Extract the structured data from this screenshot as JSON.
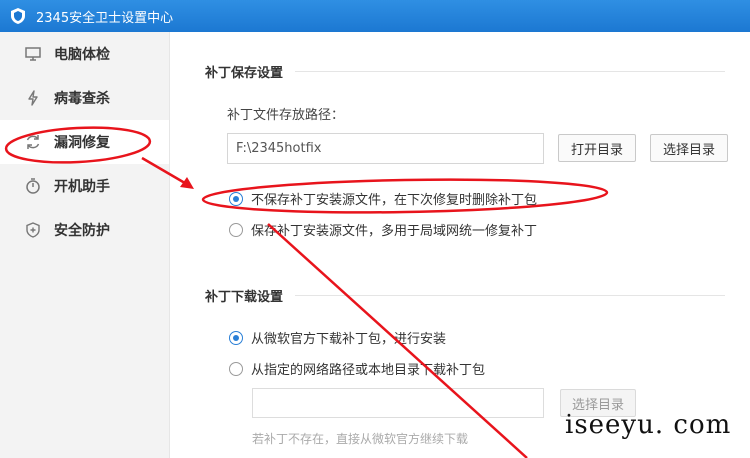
{
  "window": {
    "title": "2345安全卫士设置中心"
  },
  "sidebar": {
    "items": [
      {
        "label": "电脑体检",
        "icon": "monitor-icon"
      },
      {
        "label": "病毒查杀",
        "icon": "lightning-icon"
      },
      {
        "label": "漏洞修复",
        "icon": "refresh-icon"
      },
      {
        "label": "开机助手",
        "icon": "stopwatch-icon"
      },
      {
        "label": "安全防护",
        "icon": "shield-plus-icon"
      }
    ],
    "active_index": 2
  },
  "patch_save": {
    "section_title": "补丁保存设置",
    "path_label": "补丁文件存放路径：",
    "path_value": "F:\\2345hotfix",
    "open_dir_button": "打开目录",
    "choose_dir_button": "选择目录",
    "options": [
      {
        "label": "不保存补丁安装源文件，在下次修复时删除补丁包",
        "checked": true
      },
      {
        "label": "保存补丁安装源文件，多用于局域网统一修复补丁",
        "checked": false
      }
    ]
  },
  "patch_download": {
    "section_title": "补丁下载设置",
    "options": [
      {
        "label": "从微软官方下载补丁包，进行安装",
        "checked": true
      },
      {
        "label": "从指定的网络路径或本地目录下载补丁包",
        "checked": false
      }
    ],
    "choose_dir_button": "选择目录",
    "hint": "若补丁不存在，直接从微软官方继续下载"
  },
  "watermark": "iseeyu. com",
  "colors": {
    "titlebar": "#1c78d2",
    "annotation": "#e8141c",
    "accent": "#2a7fd6"
  }
}
